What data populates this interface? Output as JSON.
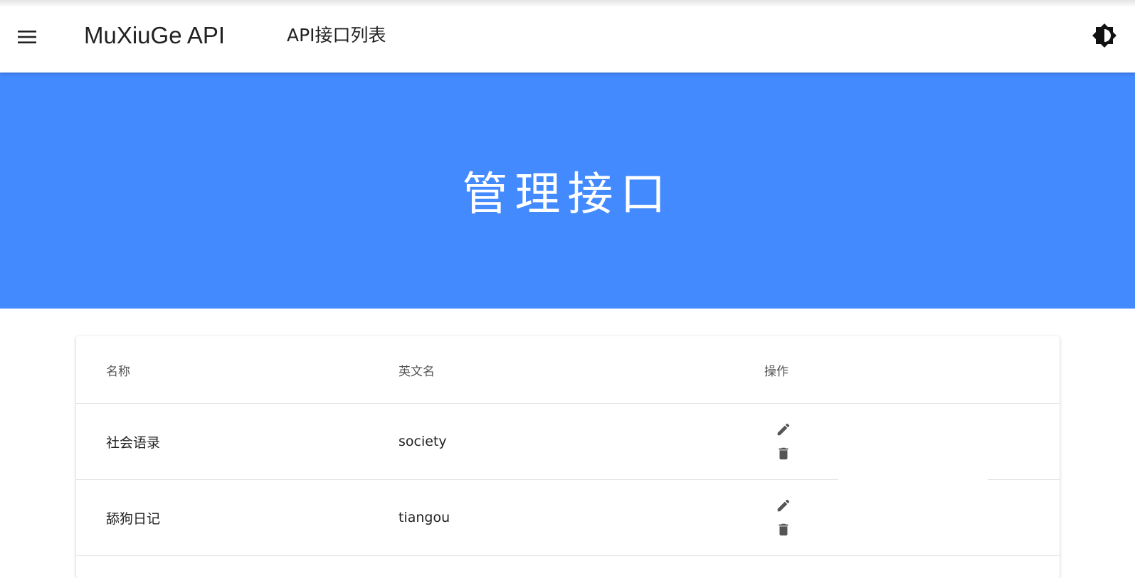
{
  "colors": {
    "hero_background": "#448aff",
    "icon": "#555555",
    "text": "#222222"
  },
  "app_bar": {
    "menu_icon": "menu-icon",
    "title": "MuXiuGe API",
    "subtitle": "API接口列表",
    "theme_icon": "brightness-icon"
  },
  "hero": {
    "title": "管理接口"
  },
  "table": {
    "headers": [
      "名称",
      "英文名",
      "操作"
    ],
    "rows": [
      {
        "name": "社会语录",
        "english_name": "society",
        "actions": [
          "edit-icon",
          "delete-icon"
        ]
      },
      {
        "name": "舔狗日记",
        "english_name": "tiangou",
        "actions": [
          "edit-icon",
          "delete-icon"
        ]
      }
    ]
  }
}
